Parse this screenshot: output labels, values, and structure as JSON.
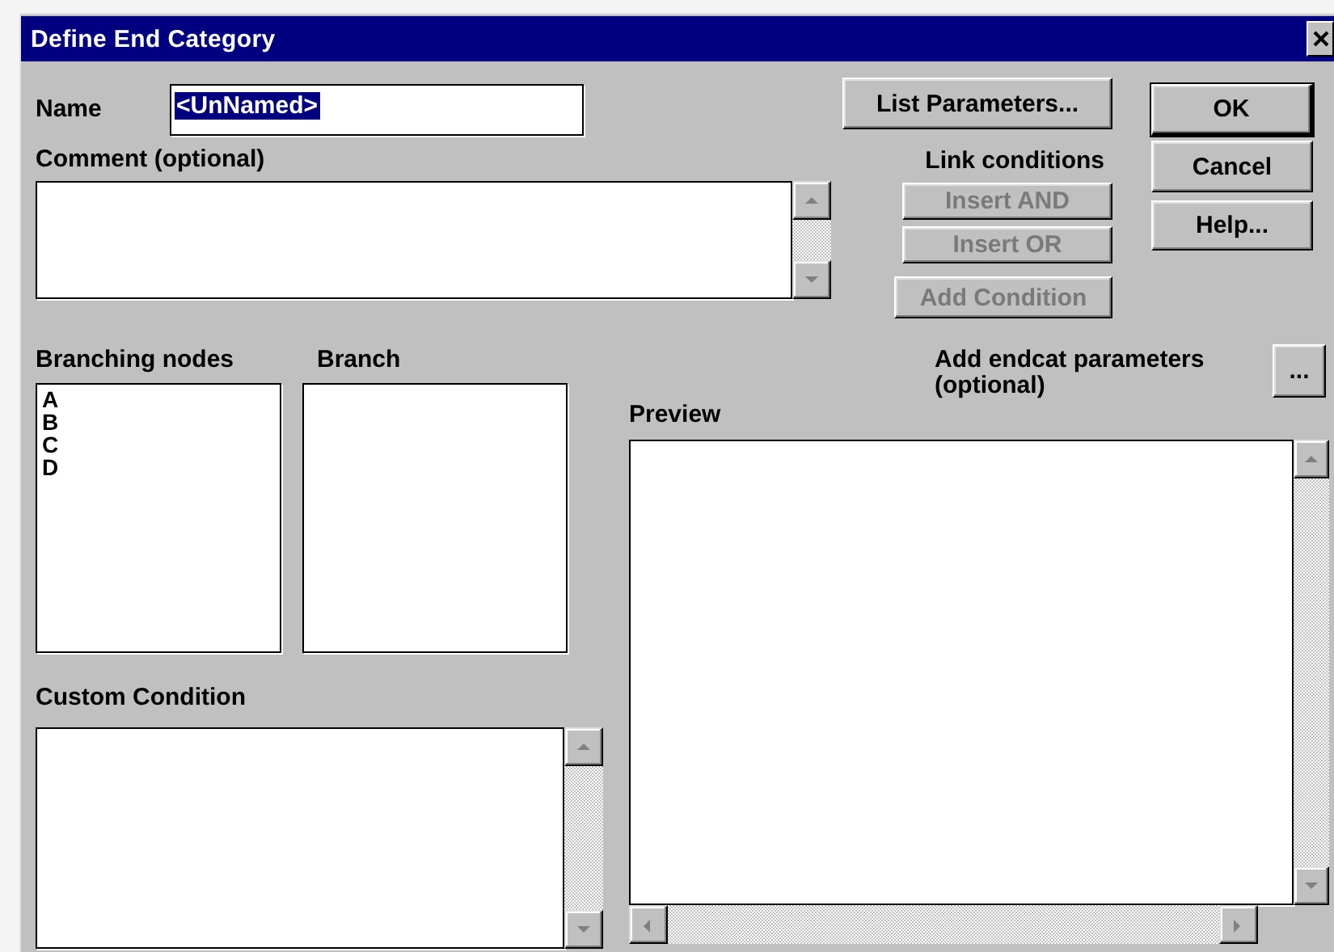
{
  "window": {
    "title": "Define End Category"
  },
  "name_field": {
    "label": "Name",
    "value": "<UnNamed>",
    "text_selected": true
  },
  "comment": {
    "label": "Comment (optional)"
  },
  "list_parameters_button": {
    "label": "List Parameters...",
    "disabled": false
  },
  "dialog_buttons": [
    {
      "label": "OK",
      "default": true,
      "disabled": false
    },
    {
      "label": "Cancel",
      "default": false,
      "disabled": false
    },
    {
      "label": "Help...",
      "default": false,
      "disabled": false
    }
  ],
  "link_conditions": {
    "label": "Link conditions",
    "buttons": [
      {
        "label": "Insert AND",
        "disabled": true
      },
      {
        "label": "Insert OR",
        "disabled": true
      },
      {
        "label": "Add Condition",
        "disabled": true
      }
    ]
  },
  "branching_nodes": {
    "label": "Branching nodes",
    "items": [
      {
        "label": "A",
        "selected": false
      },
      {
        "label": "B",
        "selected": false
      },
      {
        "label": "C",
        "selected": false
      },
      {
        "label": "D",
        "selected": false
      }
    ]
  },
  "branch": {
    "label": "Branch"
  },
  "custom_condition": {
    "label": "Custom Condition"
  },
  "endcat_parameters": {
    "label": "Add endcat parameters (optional)",
    "button": "..."
  },
  "preview": {
    "label": "Preview"
  }
}
